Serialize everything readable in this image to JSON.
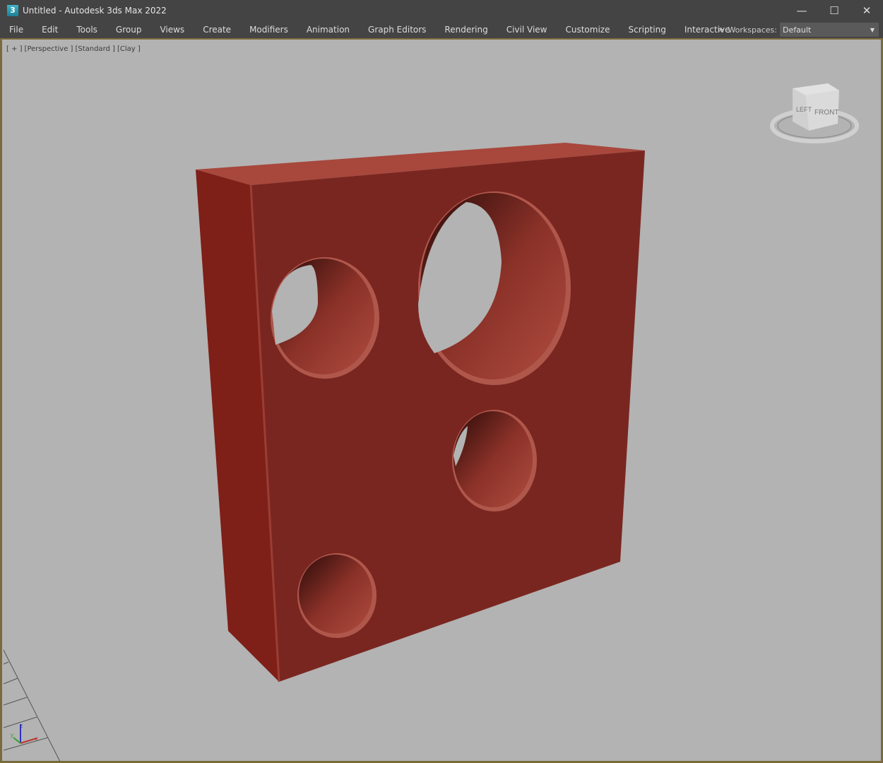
{
  "window": {
    "title": "Untitled - Autodesk 3ds Max 2022",
    "app_icon": "3",
    "controls": [
      "minimize",
      "maximize",
      "close"
    ]
  },
  "menu": [
    "File",
    "Edit",
    "Tools",
    "Group",
    "Views",
    "Create",
    "Modifiers",
    "Animation",
    "Graph Editors",
    "Rendering",
    "Civil View",
    "Customize",
    "Scripting",
    "Interactive"
  ],
  "workspaces": {
    "label": "Workspaces:",
    "value": "Default"
  },
  "viewport": {
    "labels": [
      "[ + ]",
      "[Perspective ]",
      "[Standard ]",
      "[Clay ]"
    ],
    "viewcube": {
      "left": "LEFT",
      "front": "FRONT"
    },
    "axes": {
      "x": "x",
      "y": "y",
      "z": "z"
    },
    "colors": {
      "object": "#7a2620",
      "background": "#b3b3b3"
    }
  }
}
